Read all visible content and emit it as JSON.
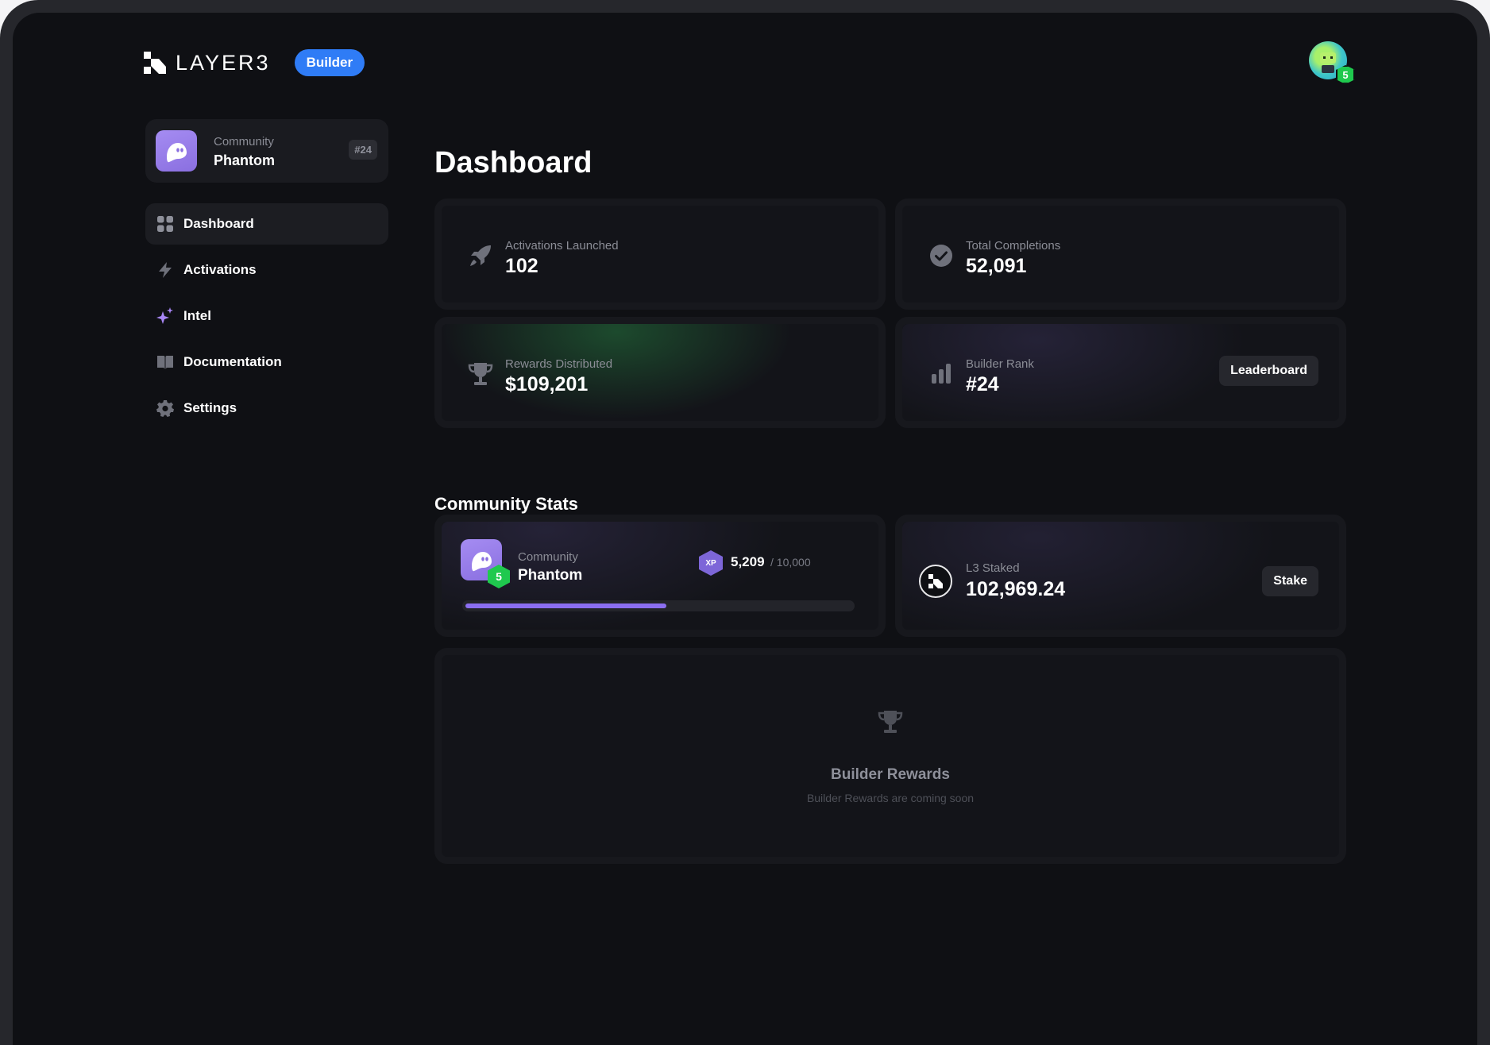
{
  "brand": {
    "wordmark": "LAYER3",
    "badge": "Builder"
  },
  "user": {
    "level": "5"
  },
  "sidebar": {
    "community": {
      "label": "Community",
      "name": "Phantom",
      "rank": "#24"
    },
    "items": [
      {
        "label": "Dashboard",
        "icon": "grid-icon",
        "active": true
      },
      {
        "label": "Activations",
        "icon": "bolt-icon"
      },
      {
        "label": "Intel",
        "icon": "sparkle-icon"
      },
      {
        "label": "Documentation",
        "icon": "book-icon"
      },
      {
        "label": "Settings",
        "icon": "gear-icon"
      }
    ]
  },
  "main": {
    "title": "Dashboard",
    "stats": {
      "activations": {
        "label": "Activations Launched",
        "value": "102",
        "icon": "rocket-icon"
      },
      "completions": {
        "label": "Total Completions",
        "value": "52,091",
        "icon": "check-circle-icon"
      },
      "rewards": {
        "label": "Rewards Distributed",
        "value": "$109,201",
        "icon": "trophy-icon"
      },
      "rank": {
        "label": "Builder Rank",
        "value": "#24",
        "icon": "bar-chart-icon",
        "button": "Leaderboard"
      }
    },
    "community_stats": {
      "title": "Community Stats",
      "community": {
        "label": "Community",
        "name": "Phantom",
        "level": "5",
        "xp_badge": "XP",
        "xp": "5,209",
        "xp_max": "/ 10,000",
        "xp_progress": 0.5209
      },
      "staked": {
        "label": "L3 Staked",
        "value": "102,969.24",
        "button": "Stake"
      },
      "builder_rewards": {
        "title": "Builder Rewards",
        "subtitle": "Builder Rewards are coming soon"
      }
    }
  },
  "colors": {
    "accent_blue": "#2f7cf6",
    "accent_purple": "#8b6ef0",
    "level_green": "#1fc94e",
    "background": "#0f1014"
  }
}
